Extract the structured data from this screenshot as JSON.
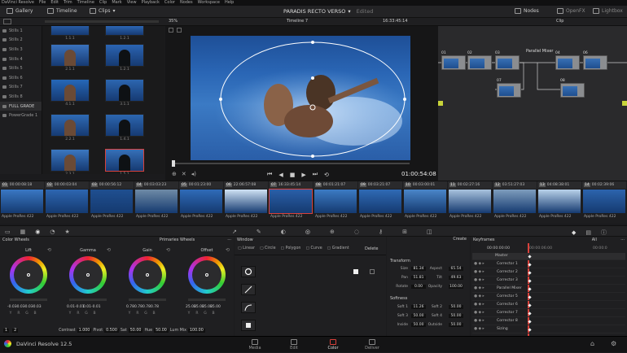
{
  "menu": [
    "DaVinci Resolve",
    "File",
    "Edit",
    "Trim",
    "Timeline",
    "Clip",
    "Mark",
    "View",
    "Playback",
    "Color",
    "Nodes",
    "Workspace",
    "Help"
  ],
  "toolbar": {
    "gallery": "Gallery",
    "timeline": "Timeline",
    "clips": "Clips",
    "project_title": "PARADIS RECTO VERSO",
    "edited": "Edited",
    "nodes": "Nodes",
    "openfx": "OpenFX",
    "lightbox": "Lightbox"
  },
  "viewer": {
    "zoom": "35%",
    "timeline_name": "Timeline 7",
    "timecode": "16:33:45:14",
    "clip_mode": "Clip",
    "playhead_tc": "01:00:54:08"
  },
  "stills": [
    "Stills 1",
    "Stills 2",
    "Stills 3",
    "Stills 4",
    "Stills 5",
    "Stills 6",
    "Stills 7",
    "Stills 8",
    "FULL GRADE",
    "PowerGrade 1"
  ],
  "gallery": [
    "1.1.1",
    "1.2.1",
    "2.1.1",
    "1.2.1",
    "4.1.1",
    "3.1.1",
    "2.2.1",
    "1.4.1",
    "2.3.1",
    "1.5.1"
  ],
  "nodes": {
    "labels": [
      "01",
      "02",
      "03",
      "04",
      "06",
      "07",
      "08"
    ],
    "parallel_mixer": "Parallel Mixer"
  },
  "clips": [
    {
      "num": "01",
      "tc": "00:00:08:18",
      "codec": "Apple ProRes 422"
    },
    {
      "num": "02",
      "tc": "00:00:03:04",
      "codec": "Apple ProRes 422"
    },
    {
      "num": "03",
      "tc": "00:00:56:12",
      "codec": "Apple ProRes 422"
    },
    {
      "num": "04",
      "tc": "00:03:03:23",
      "codec": "Apple ProRes 422"
    },
    {
      "num": "05",
      "tc": "00:01:23:00",
      "codec": "Apple ProRes 422"
    },
    {
      "num": "06",
      "tc": "22:06:57:08",
      "codec": "Apple ProRes 422"
    },
    {
      "num": "07",
      "tc": "16:33:45:14",
      "codec": "Apple ProRes 422"
    },
    {
      "num": "08",
      "tc": "00:01:21:07",
      "codec": "Apple ProRes 422"
    },
    {
      "num": "09",
      "tc": "00:03:21:07",
      "codec": "Apple ProRes 422"
    },
    {
      "num": "10",
      "tc": "00:03:00:01",
      "codec": "Apple ProRes 422"
    },
    {
      "num": "11",
      "tc": "00:02:27:16",
      "codec": "Apple ProRes 422"
    },
    {
      "num": "12",
      "tc": "03:51:27:03",
      "codec": "Apple ProRes 422"
    },
    {
      "num": "13",
      "tc": "04:08:38:01",
      "codec": "Apple ProRes 422"
    },
    {
      "num": "14",
      "tc": "00:02:39:06",
      "codec": "Apple ProRes 422"
    }
  ],
  "color_wheels": {
    "title": "Color Wheels",
    "mode": "Primaries Wheels",
    "wheels": [
      {
        "name": "Lift",
        "vals": [
          "-0.03",
          "-0.03",
          "-0.03",
          "-0.03"
        ]
      },
      {
        "name": "Gamma",
        "vals": [
          "0.01",
          "-0.01",
          "0.01",
          "-0.01"
        ]
      },
      {
        "name": "Gain",
        "vals": [
          "0.78",
          "0.78",
          "0.78",
          "0.78"
        ]
      },
      {
        "name": "Offset",
        "vals": [
          "25.00",
          "25.00",
          "25.00",
          "25.00"
        ]
      }
    ],
    "rgb": [
      "Y",
      "R",
      "G",
      "B"
    ],
    "contrast_label": "Contrast",
    "contrast": "1.000",
    "pivot_label": "Pivot",
    "pivot": "0.500",
    "sat_label": "Sat",
    "sat": "50.00",
    "hue_label": "Hue",
    "hue": "50.00",
    "lummix_label": "Lum Mix",
    "lummix": "100.00",
    "page1": "1",
    "page2": "2"
  },
  "window": {
    "title": "Window",
    "tools": [
      "Linear",
      "Circle",
      "Polygon",
      "Curve",
      "Gradient"
    ],
    "delete": "Delete",
    "create": "Create"
  },
  "transform": {
    "title": "Transform",
    "rows": [
      [
        "Size",
        "81.34",
        "Aspect",
        "65.54"
      ],
      [
        "Pan",
        "51.81",
        "Tilt",
        "49.63"
      ],
      [
        "Rotate",
        "0.00",
        "Opacity",
        "100.00"
      ]
    ],
    "softness_title": "Softness",
    "soft_rows": [
      [
        "Soft 1",
        "11.26",
        "Soft 2",
        "50.00"
      ],
      [
        "Soft 3",
        "50.00",
        "Soft 4",
        "50.00"
      ],
      [
        "Inside",
        "50.00",
        "Outside",
        "50.00"
      ]
    ]
  },
  "keyframes": {
    "title": "Keyframes",
    "filter": "All",
    "tc_start": "00:00:00:00",
    "tc_mid": "00:00:06:00",
    "tc_end": "00:00:0",
    "rows": [
      "Master",
      "Corrector 1",
      "Corrector 2",
      "Corrector 3",
      "Parallel Mixer",
      "Corrector 5",
      "Corrector 6",
      "Corrector 7",
      "Corrector 8",
      "Sizing"
    ]
  },
  "pages": {
    "media": "Media",
    "edit": "Edit",
    "color": "Color",
    "deliver": "Deliver"
  },
  "app_name": "DaVinci Resolve 12.5"
}
